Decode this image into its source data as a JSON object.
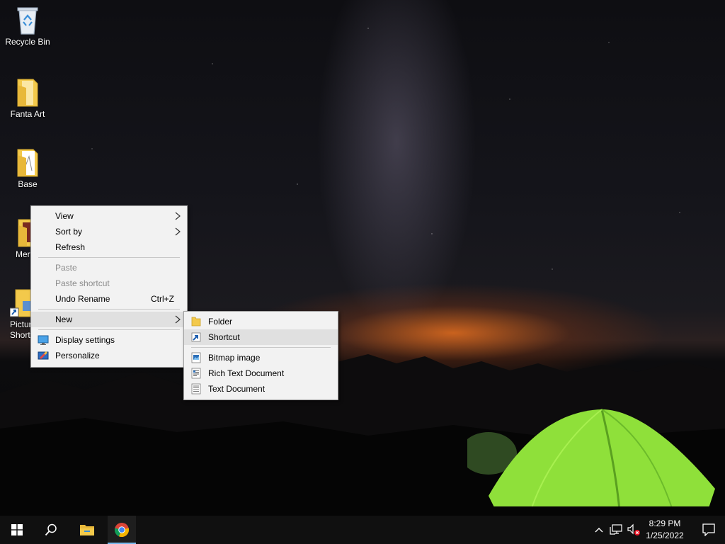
{
  "desktop": {
    "icons": [
      {
        "label": "Recycle Bin",
        "icon": "recycle-bin-icon"
      },
      {
        "label": "Fanta Art",
        "icon": "folder-icon"
      },
      {
        "label": "Base",
        "icon": "folder-icon"
      },
      {
        "label": "Mer",
        "icon": "folder-icon"
      },
      {
        "label": "Pictur",
        "label2": "Short",
        "icon": "shortcut-folder-icon"
      }
    ]
  },
  "context_menu": {
    "view": "View",
    "sort_by": "Sort by",
    "refresh": "Refresh",
    "paste": "Paste",
    "paste_shortcut": "Paste shortcut",
    "undo_rename": "Undo Rename",
    "undo_shortcut": "Ctrl+Z",
    "new": "New",
    "display_settings": "Display settings",
    "personalize": "Personalize"
  },
  "new_submenu": {
    "folder": "Folder",
    "shortcut": "Shortcut",
    "bitmap": "Bitmap image",
    "rich_text": "Rich Text Document",
    "text_doc": "Text Document"
  },
  "taskbar": {
    "time": "8:29 PM",
    "date": "1/25/2022"
  },
  "colors": {
    "accent": "#4cc2ff",
    "folder": "#f3c94b",
    "menu_bg": "#f2f2f2"
  }
}
